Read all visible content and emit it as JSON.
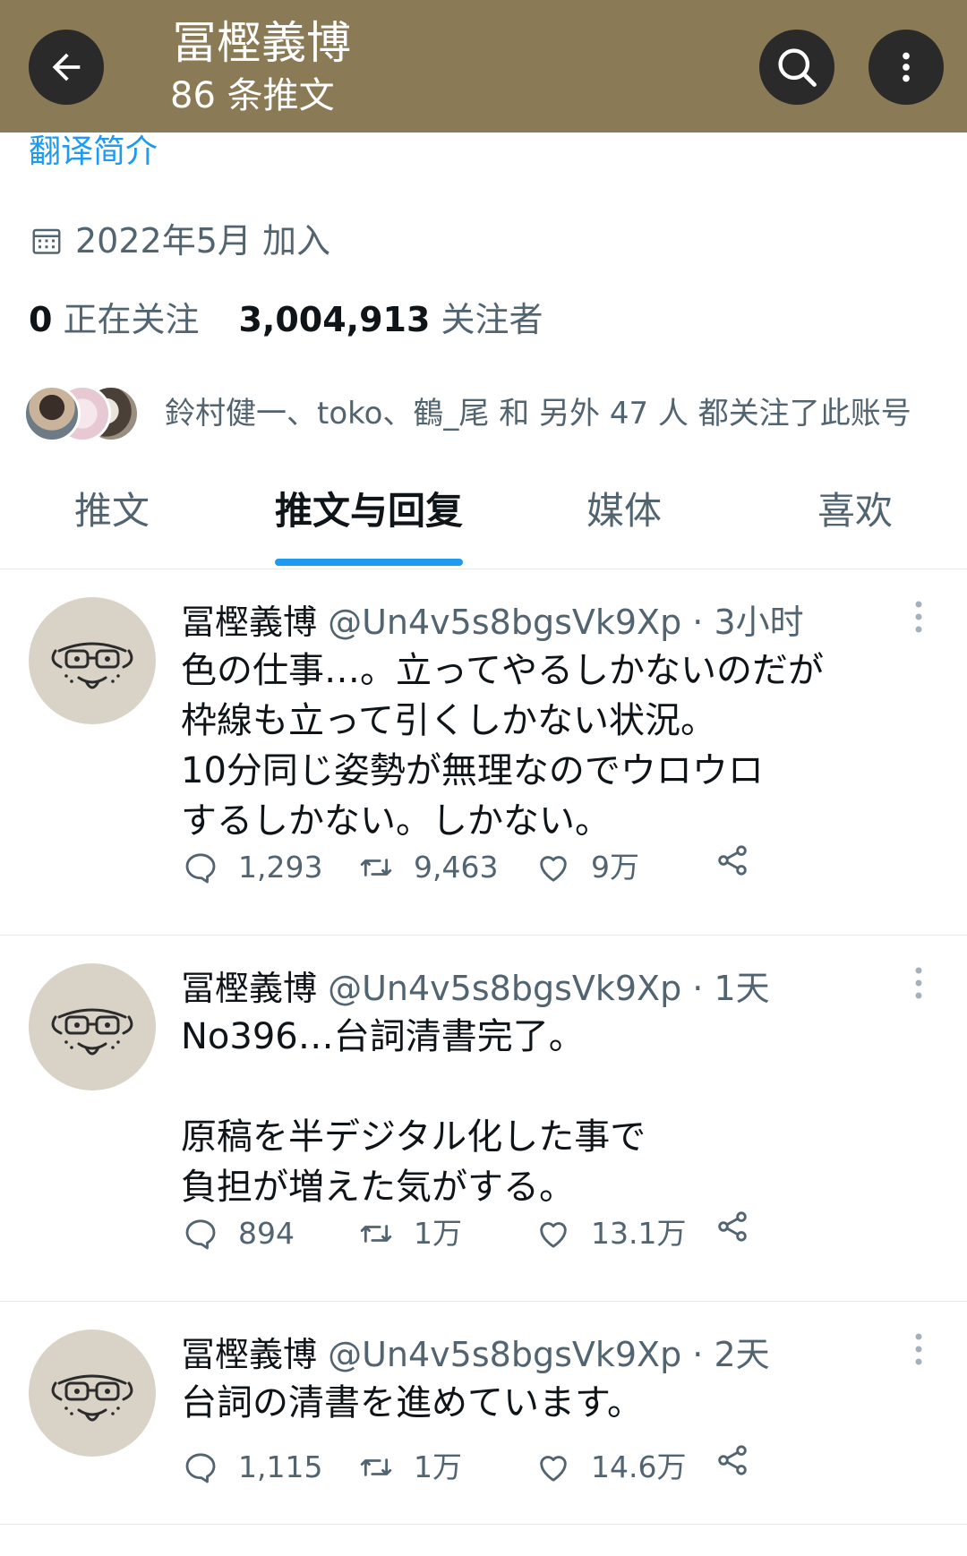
{
  "header": {
    "title": "冨樫義博",
    "subtitle": "86 条推文"
  },
  "profile": {
    "translate_bio": "翻译简介",
    "joined": "2022年5月 加入",
    "following_count": "0",
    "following_label": "正在关注",
    "followers_count": "3,004,913",
    "followers_label": "关注者",
    "followed_by_text": "鈴村健一、toko、鶴_尾 和 另外 47 人 都关注了此账号"
  },
  "tabs": [
    "推文",
    "推文与回复",
    "媒体",
    "喜欢"
  ],
  "active_tab": "推文与回复",
  "tweets": [
    {
      "name": "冨樫義博",
      "handle": "@Un4v5s8bgsVk9Xp",
      "time": "· 3小时",
      "text": "色の仕事…。立ってやるしかないのだが\n枠線も立って引くしかない状況。\n10分同じ姿勢が無理なのでウロウロ\nするしかない。しかない。",
      "replies": "1,293",
      "retweets": "9,463",
      "likes": "9万"
    },
    {
      "name": "冨樫義博",
      "handle": "@Un4v5s8bgsVk9Xp",
      "time": "· 1天",
      "text": "No396…台詞清書完了。\n\n原稿を半デジタル化した事で\n負担が増えた気がする。",
      "replies": "894",
      "retweets": "1万",
      "likes": "13.1万"
    },
    {
      "name": "冨樫義博",
      "handle": "@Un4v5s8bgsVk9Xp",
      "time": "· 2天",
      "text": "台詞の清書を進めています。",
      "replies": "1,115",
      "retweets": "1万",
      "likes": "14.6万"
    }
  ],
  "colors": {
    "header_bg": "#8a7a55",
    "accent": "#1d9bf0",
    "secondary_text": "#536471"
  }
}
